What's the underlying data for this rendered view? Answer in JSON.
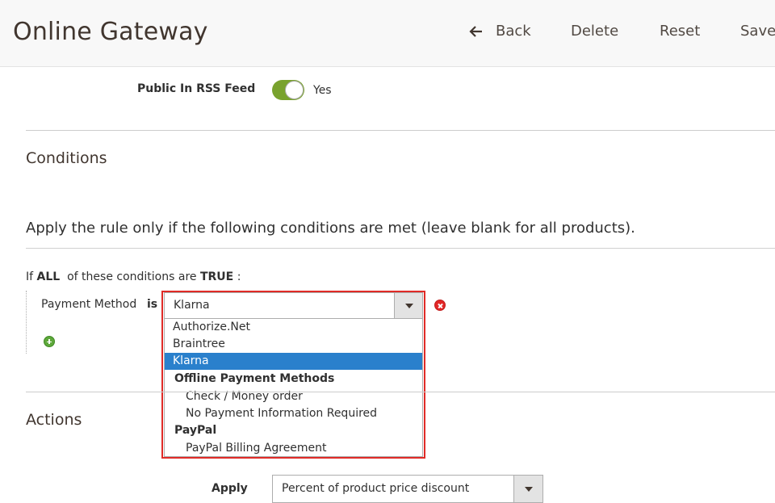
{
  "header": {
    "title": "Online Gateway",
    "back_label": "Back",
    "delete_label": "Delete",
    "reset_label": "Reset",
    "save_label": "Save"
  },
  "rss": {
    "label": "Public In RSS Feed",
    "value": "Yes",
    "enabled": true
  },
  "conditions": {
    "section_title": "Conditions",
    "rule_title": "Apply the rule only if the following conditions are met (leave blank for all products).",
    "if_prefix": "If",
    "aggregator": "ALL",
    "if_middle": "of these conditions are",
    "truth": "TRUE",
    "if_suffix": ":",
    "condition": {
      "attribute": "Payment Method",
      "operator": "is",
      "selected": "Klarna"
    },
    "dropdown_options": [
      {
        "label": "Authorize.Net",
        "kind": "top",
        "selected": false
      },
      {
        "label": "Braintree",
        "kind": "top",
        "selected": false
      },
      {
        "label": "Klarna",
        "kind": "top",
        "selected": true
      },
      {
        "label": "Offline Payment Methods",
        "kind": "group",
        "selected": false
      },
      {
        "label": "Check / Money order",
        "kind": "child",
        "selected": false
      },
      {
        "label": "No Payment Information Required",
        "kind": "child",
        "selected": false
      },
      {
        "label": "PayPal",
        "kind": "group",
        "selected": false
      },
      {
        "label": "PayPal Billing Agreement",
        "kind": "child",
        "selected": false
      }
    ]
  },
  "actions": {
    "section_title": "Actions",
    "apply_label": "Apply",
    "apply_value": "Percent of product price discount"
  },
  "colors": {
    "toggle_on": "#79a22e",
    "selected_option": "#2a80cc",
    "highlight_border": "#e02b27",
    "remove_icon": "#e22626",
    "add_icon": "#5ea83b"
  }
}
